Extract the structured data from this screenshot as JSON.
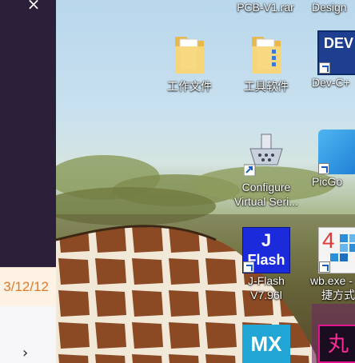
{
  "side_panel": {
    "close_glyph": "×",
    "date_text": "3/12/12",
    "chevron_glyph": "›"
  },
  "desktop": {
    "icons": [
      {
        "label": "PCB-V1.rar"
      },
      {
        "label": "Design"
      },
      {
        "label": "工作文件"
      },
      {
        "label": "工具软件"
      },
      {
        "label": "Dev-C+"
      },
      {
        "label_line1": "Configure",
        "label_line2": "Virtual Seri..."
      },
      {
        "label": "PicGo"
      },
      {
        "label_line1": "J-Flash",
        "label_line2": "V7.96l",
        "tile_text_top": "J",
        "tile_text_bottom": "Flash"
      },
      {
        "label_line1": "wb.exe -",
        "label_line2": "捷方式",
        "tile_text": "4"
      },
      {
        "tile_text": "MX"
      },
      {
        "tile_text": "丸"
      }
    ],
    "dev_tile_text": "DEV"
  }
}
